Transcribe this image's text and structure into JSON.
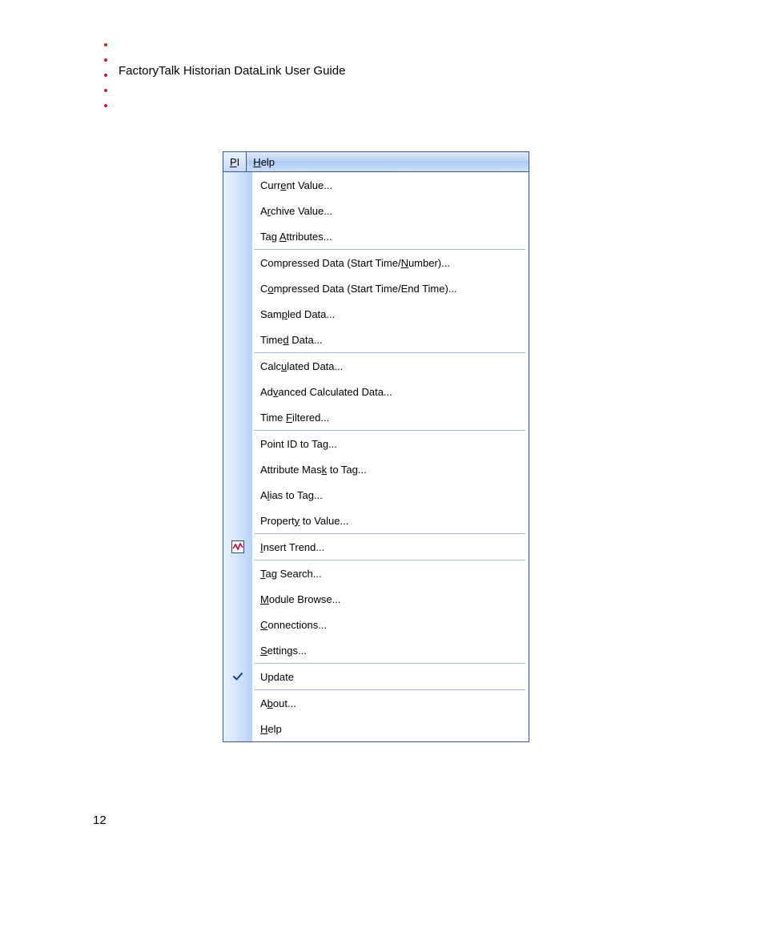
{
  "header": {
    "title": "FactoryTalk Historian DataLink User Guide"
  },
  "page_number": "12",
  "menubar": {
    "items": [
      {
        "label": "PI",
        "mnemonic_pos": 0,
        "selected": true
      },
      {
        "label": "Help",
        "mnemonic_pos": 0,
        "selected": false
      }
    ]
  },
  "menu": {
    "groups": [
      [
        {
          "label": "Current Value...",
          "mnemonic": "e",
          "icon": null,
          "checked": false
        },
        {
          "label": "Archive Value...",
          "mnemonic": "r",
          "icon": null,
          "checked": false
        },
        {
          "label": "Tag Attributes...",
          "mnemonic": "A",
          "icon": null,
          "checked": false
        }
      ],
      [
        {
          "label": "Compressed Data (Start Time/Number)...",
          "mnemonic": "N",
          "icon": null,
          "checked": false
        },
        {
          "label": "Compressed Data (Start Time/End Time)...",
          "mnemonic": "o",
          "icon": null,
          "checked": false
        },
        {
          "label": "Sampled Data...",
          "mnemonic": "p",
          "icon": null,
          "checked": false
        },
        {
          "label": "Timed Data...",
          "mnemonic": "d",
          "icon": null,
          "checked": false
        }
      ],
      [
        {
          "label": "Calculated Data...",
          "mnemonic": "u",
          "icon": null,
          "checked": false
        },
        {
          "label": "Advanced Calculated Data...",
          "mnemonic": "v",
          "icon": null,
          "checked": false
        },
        {
          "label": "Time Filtered...",
          "mnemonic": "F",
          "icon": null,
          "checked": false
        }
      ],
      [
        {
          "label": "Point ID to Tag...",
          "mnemonic": "g",
          "icon": null,
          "checked": false
        },
        {
          "label": "Attribute Mask to Tag...",
          "mnemonic": "k",
          "icon": null,
          "checked": false
        },
        {
          "label": "Alias to Tag...",
          "mnemonic": "l",
          "icon": null,
          "checked": false
        },
        {
          "label": "Property to Value...",
          "mnemonic": "y",
          "icon": null,
          "checked": false
        }
      ],
      [
        {
          "label": "Insert Trend...",
          "mnemonic": "I",
          "icon": "trend",
          "checked": false
        }
      ],
      [
        {
          "label": "Tag Search...",
          "mnemonic": "T",
          "icon": null,
          "checked": false
        },
        {
          "label": "Module Browse...",
          "mnemonic": "M",
          "icon": null,
          "checked": false
        },
        {
          "label": "Connections...",
          "mnemonic": "C",
          "icon": null,
          "checked": false
        },
        {
          "label": "Settings...",
          "mnemonic": "S",
          "icon": null,
          "checked": false
        }
      ],
      [
        {
          "label": "Update",
          "mnemonic": null,
          "icon": null,
          "checked": true
        }
      ],
      [
        {
          "label": "About...",
          "mnemonic": "b",
          "icon": null,
          "checked": false
        },
        {
          "label": "Help",
          "mnemonic": "H",
          "icon": null,
          "checked": false
        }
      ]
    ]
  }
}
